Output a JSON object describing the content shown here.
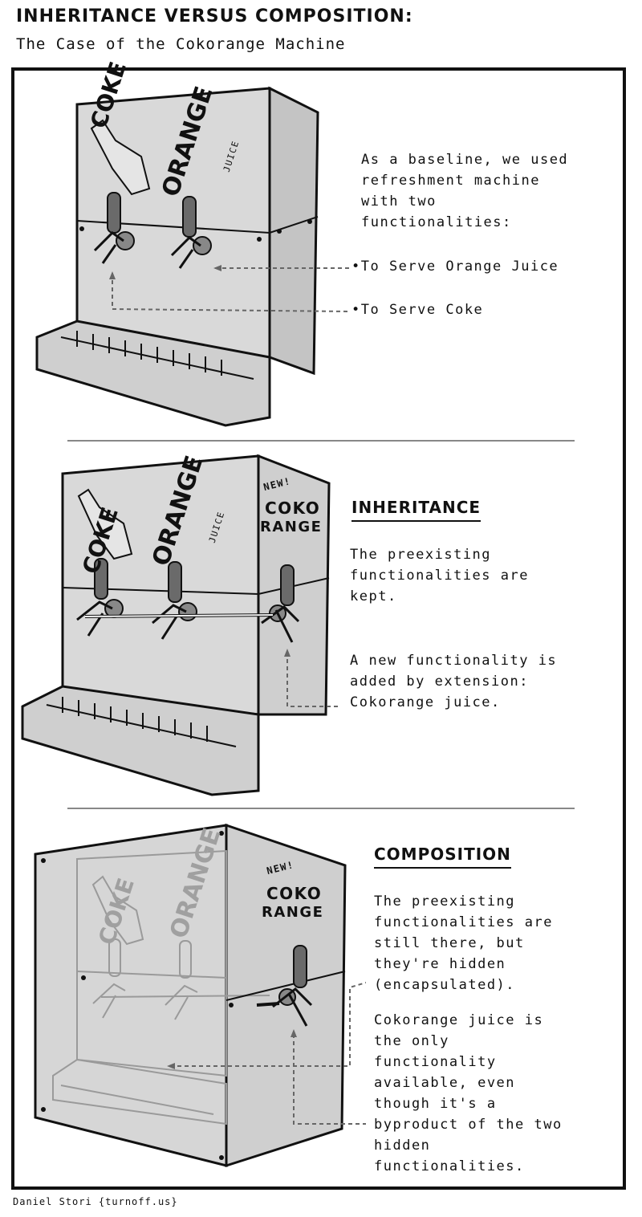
{
  "header": {
    "title": "INHERITANCE VERSUS COMPOSITION:",
    "subtitle": "The Case of the Cokorange Machine"
  },
  "panel1": {
    "caption": "As a baseline, we used\nrefreshment machine\nwith two\nfunctionalities:",
    "bullet_orange": "•To Serve Orange Juice",
    "bullet_coke": "•To Serve Coke",
    "label_coke": "COKE",
    "label_orange": "ORANGE",
    "label_juice": "JUICE"
  },
  "panel2": {
    "heading": "INHERITANCE",
    "text1": "The preexisting\nfunctionalities are\nkept.",
    "text2": "A new functionality is\nadded by extension:\nCokorange juice.",
    "badge_new": "NEW!",
    "badge_line1": "COKO",
    "badge_line2": "RANGE",
    "label_coke": "COKE",
    "label_orange": "ORANGE",
    "label_juice": "JUICE"
  },
  "panel3": {
    "heading": "COMPOSITION",
    "text1": "The preexisting\nfunctionalities are\nstill there, but\nthey're hidden\n(encapsulated).",
    "text2": "Cokorange juice is\nthe only\nfunctionality\navailable, even\nthough it's a\nbyproduct of the two\nhidden\nfunctionalities.",
    "badge_new": "NEW!",
    "badge_line1": "COKO",
    "badge_line2": "RANGE",
    "label_coke": "COKE",
    "label_orange": "ORANGE"
  },
  "footer": {
    "credit": "Daniel Stori {turnoff.us}"
  },
  "colors": {
    "machine": "#d9d9d9",
    "machine_side": "#c4c4c4",
    "tap": "#6a6a6a",
    "ink": "#111111"
  }
}
